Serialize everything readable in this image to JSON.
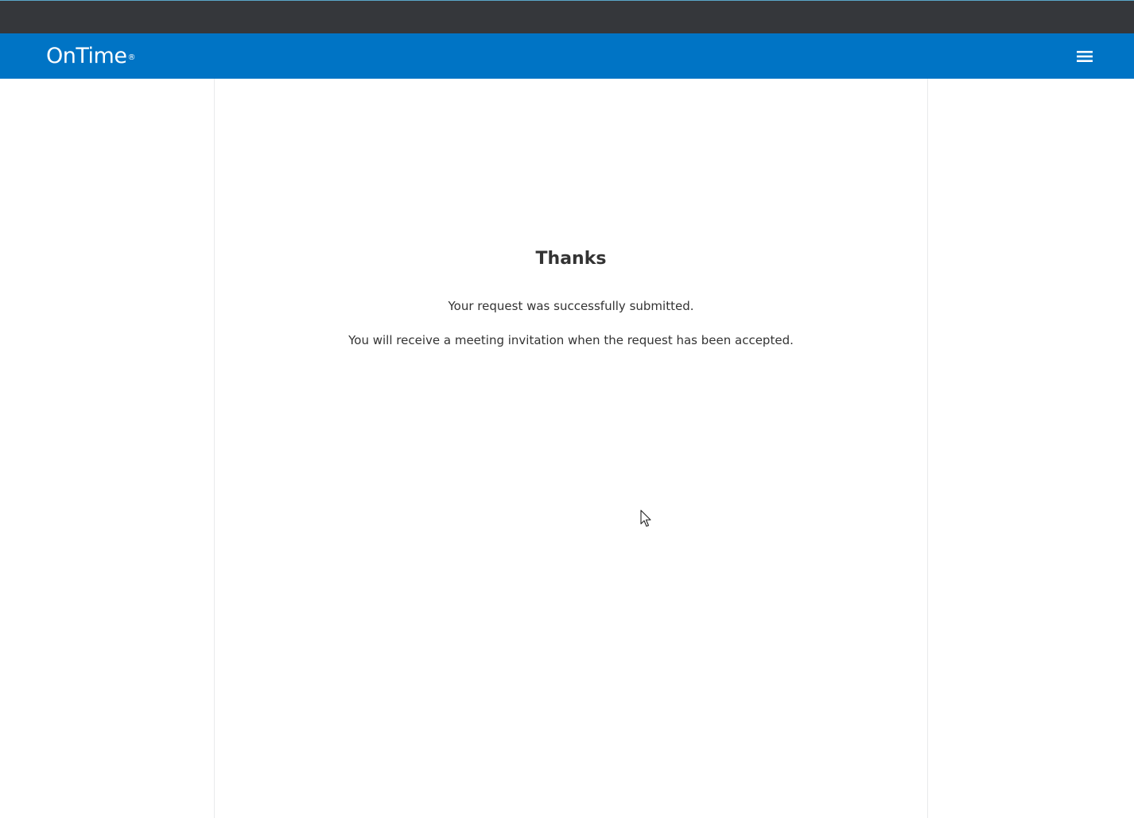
{
  "header": {
    "brand_name": "OnTime",
    "brand_mark": "®",
    "menu_icon": "hamburger-menu-icon"
  },
  "confirmation": {
    "title": "Thanks",
    "line_1": "Your request was successfully submitted.",
    "line_2": "You will receive a meeting invitation when the request has been accepted."
  },
  "colors": {
    "top_strip": "#35373b",
    "app_bar": "#0074c5",
    "text": "#333333",
    "panel_border": "#e9eaec"
  }
}
